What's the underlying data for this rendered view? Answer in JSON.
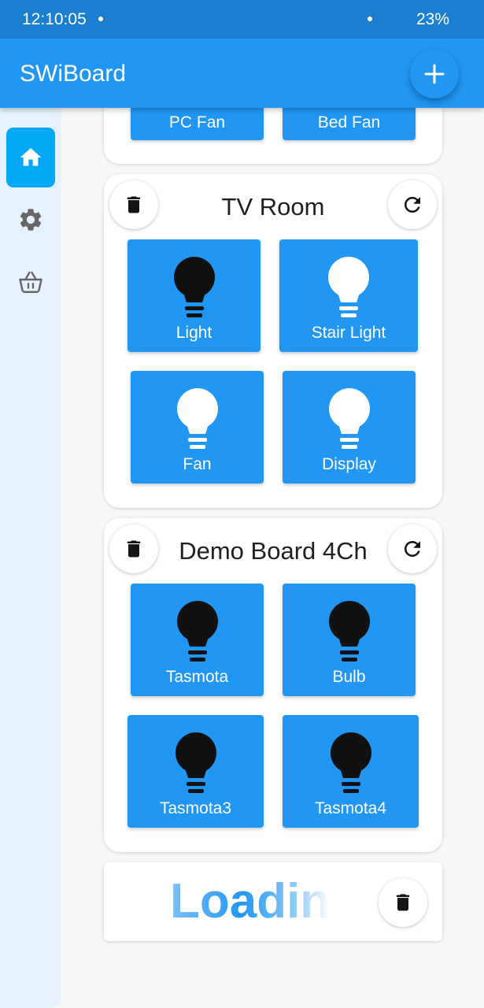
{
  "status_bar": {
    "time": "12:10:05",
    "battery": "23%"
  },
  "app_bar": {
    "title": "SWiBoard",
    "add_icon": "plus-icon"
  },
  "sidebar": {
    "items": [
      {
        "icon": "home-icon",
        "selected": true
      },
      {
        "icon": "gear-icon",
        "selected": false
      },
      {
        "icon": "basket-icon",
        "selected": false
      }
    ]
  },
  "boards": [
    {
      "switches": [
        {
          "label": "PC Fan"
        },
        {
          "label": "Bed Fan"
        }
      ]
    },
    {
      "name": "TV Room",
      "switches": [
        {
          "label": "Light",
          "state": "on",
          "bulb_color": "#111111"
        },
        {
          "label": "Stair Light",
          "state": "off",
          "bulb_color": "#ffffff"
        },
        {
          "label": "Fan",
          "state": "off",
          "bulb_color": "#ffffff"
        },
        {
          "label": "Display",
          "state": "off",
          "bulb_color": "#ffffff"
        }
      ]
    },
    {
      "name": "Demo Board 4Ch",
      "switches": [
        {
          "label": "Tasmota",
          "state": "on",
          "bulb_color": "#111111"
        },
        {
          "label": "Bulb",
          "state": "on",
          "bulb_color": "#111111"
        },
        {
          "label": "Tasmota3",
          "state": "on",
          "bulb_color": "#111111"
        },
        {
          "label": "Tasmota4",
          "state": "on",
          "bulb_color": "#111111"
        }
      ]
    },
    {
      "loading_text": "Loadin"
    }
  ],
  "colors": {
    "primary": "#2196f3",
    "status_bar": "#1b7fd0",
    "nav_active": "#03a9f4",
    "sidebar_bg": "#e5f1fc"
  }
}
